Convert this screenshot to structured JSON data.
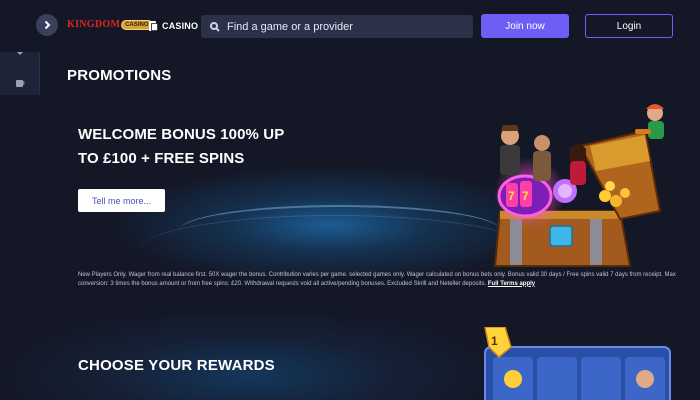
{
  "rail": {
    "items": [
      {
        "icon": "grid-icon"
      },
      {
        "icon": "heart-icon"
      },
      {
        "icon": "slot-machine-icon"
      },
      {
        "icon": "gift-icon",
        "active": true
      },
      {
        "icon": "trophy-icon"
      },
      {
        "icon": "chip-icon"
      },
      {
        "icon": "chat-icon"
      }
    ]
  },
  "header": {
    "logo_text": "KINGDOM",
    "logo_badge": "CASINO",
    "casino_label": "CASINO",
    "search_placeholder": "Find a game or a provider",
    "join_label": "Join now",
    "login_label": "Login"
  },
  "main": {
    "page_title": "PROMOTIONS",
    "welcome": {
      "title_line1": "WELCOME BONUS 100% UP",
      "title_line2": "TO £100 + FREE SPINS",
      "cta_label": "Tell me more...",
      "terms_text": "New Players Only. Wager from real balance first. 50X wager the bonus. Contribution varies per game. selected games only. Wager calculated on bonus bets only. Bonus valid 30 days / Free spins valid 7 days from receipt. Max conversion: 3 times the bonus amount or from free spins: £20. Withdrawal requests void all active/pending bonuses. Excluded Skrill and Neteller deposits.",
      "terms_link": "Full Terms apply"
    },
    "rewards": {
      "title": "CHOOSE YOUR REWARDS"
    }
  },
  "colors": {
    "background": "#141726",
    "accent": "#6f5ef6",
    "rail": "#1f2338",
    "logo_red": "#e0231c"
  }
}
